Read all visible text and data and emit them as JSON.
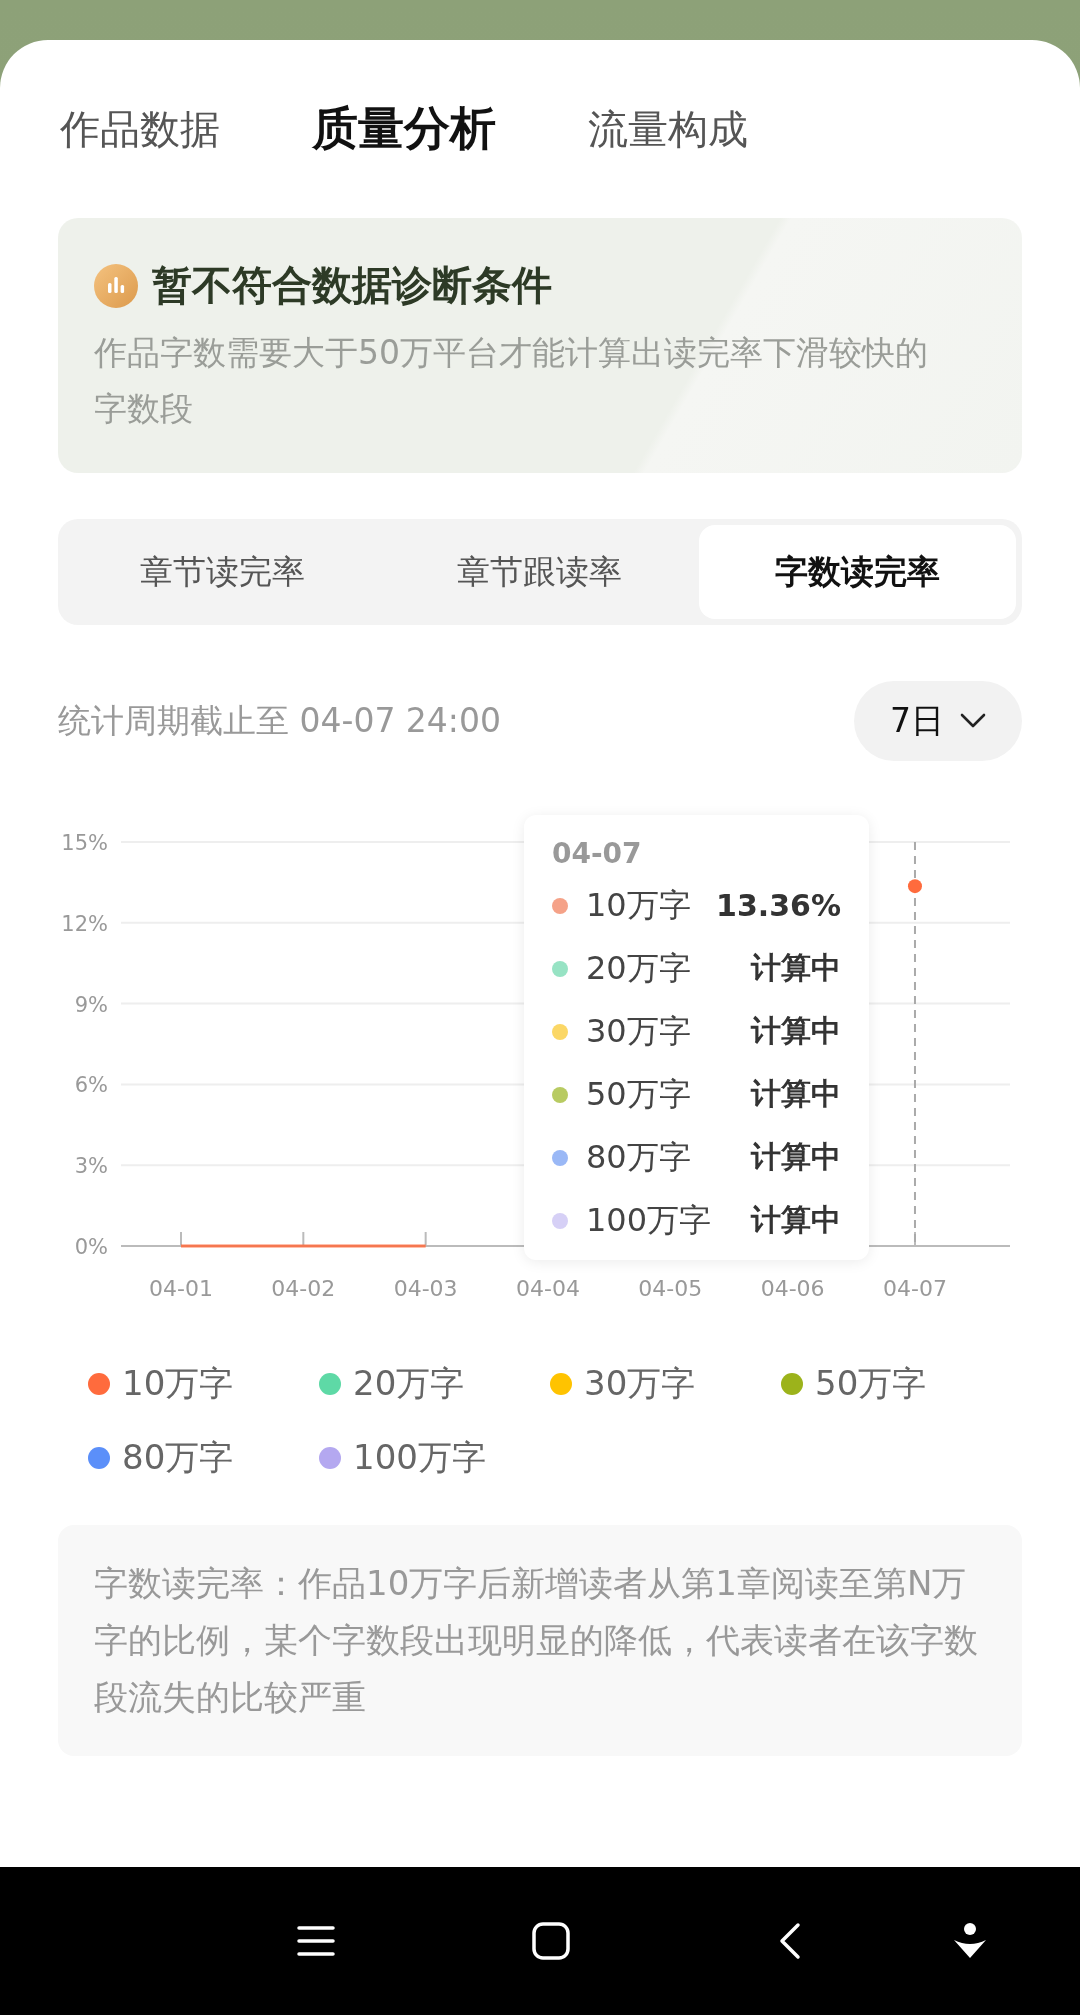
{
  "tabs": [
    {
      "label": "作品数据",
      "selected": false
    },
    {
      "label": "质量分析",
      "selected": true
    },
    {
      "label": "流量构成",
      "selected": false
    }
  ],
  "notice": {
    "title": "暂不符合数据诊断条件",
    "text": "作品字数需要大于50万平台才能计算出读完率下滑较快的字数段"
  },
  "metric_tabs": [
    {
      "label": "章节读完率",
      "selected": false
    },
    {
      "label": "章节跟读率",
      "selected": false
    },
    {
      "label": "字数读完率",
      "selected": true
    }
  ],
  "period": {
    "text": "统计周期截止至 04-07 24:00",
    "range": "7日"
  },
  "chart": {
    "chart_data": {
      "type": "line",
      "grid": true,
      "ref_lines": [
        {
          "axis": "x",
          "value": "04-07"
        }
      ],
      "categories": [
        "04-01",
        "04-02",
        "04-03",
        "04-04",
        "04-05",
        "04-06",
        "04-07"
      ],
      "ylim": [
        0,
        15
      ],
      "yticks": [
        {
          "value": 0,
          "label": "0%"
        },
        {
          "value": 3,
          "label": "3%"
        },
        {
          "value": 6,
          "label": "6%"
        },
        {
          "value": 9,
          "label": "9%"
        },
        {
          "value": 12,
          "label": "12%"
        },
        {
          "value": 15,
          "label": "15%"
        }
      ],
      "series": [
        {
          "name": "10万字",
          "color": "#ff6b3d",
          "values": [
            0,
            0,
            0,
            null,
            null,
            null,
            13.36
          ]
        },
        {
          "name": "20万字",
          "color": "#5ed9a6",
          "values": [
            null,
            null,
            null,
            null,
            null,
            null,
            null
          ]
        },
        {
          "name": "30万字",
          "color": "#ffc300",
          "values": [
            null,
            null,
            null,
            null,
            null,
            null,
            null
          ]
        },
        {
          "name": "50万字",
          "color": "#9cb31b",
          "values": [
            null,
            null,
            null,
            null,
            null,
            null,
            null
          ]
        },
        {
          "name": "80万字",
          "color": "#5b8ff9",
          "values": [
            null,
            null,
            null,
            null,
            null,
            null,
            null
          ]
        },
        {
          "name": "100万字",
          "color": "#b4a8f0",
          "values": [
            null,
            null,
            null,
            null,
            null,
            null,
            null
          ]
        }
      ]
    },
    "tooltip": {
      "date": "04-07",
      "rows": [
        {
          "name": "10万字",
          "value": "13.36%",
          "color": "#f5a288"
        },
        {
          "name": "20万字",
          "value": "计算中",
          "color": "#97e3c4"
        },
        {
          "name": "30万字",
          "value": "计算中",
          "color": "#fbd766"
        },
        {
          "name": "50万字",
          "value": "计算中",
          "color": "#b8cb62"
        },
        {
          "name": "80万字",
          "value": "计算中",
          "color": "#9ab8f6"
        },
        {
          "name": "100万字",
          "value": "计算中",
          "color": "#d6d0f6"
        }
      ]
    }
  },
  "note": "字数读完率：作品10万字后新增读者从第1章阅读至第N万字的比例，某个字数段出现明显的降低，代表读者在该字数段流失的比较严重"
}
